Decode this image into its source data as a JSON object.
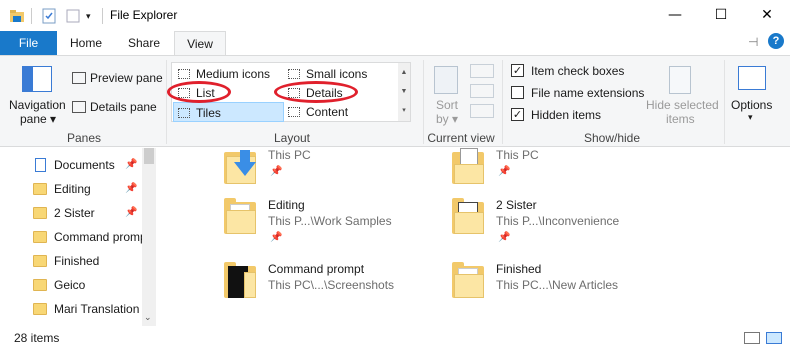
{
  "window": {
    "title": "File Explorer",
    "minimize": "—",
    "maximize": "☐",
    "close": "✕"
  },
  "tabs": {
    "file": "File",
    "home": "Home",
    "share": "Share",
    "view": "View"
  },
  "ribbon": {
    "panes": {
      "navigation_pane_line1": "Navigation",
      "navigation_pane_line2": "pane ▾",
      "preview_pane": "Preview pane",
      "details_pane": "Details pane",
      "group_label": "Panes"
    },
    "layout": {
      "medium_icons": "Medium icons",
      "small_icons": "Small icons",
      "list": "List",
      "details": "Details",
      "tiles": "Tiles",
      "content": "Content",
      "group_label": "Layout"
    },
    "current_view": {
      "sort_by_line1": "Sort",
      "sort_by_line2": "by ▾",
      "group_label": "Current view"
    },
    "show_hide": {
      "item_check_boxes": "Item check boxes",
      "item_check_boxes_checked": true,
      "file_name_extensions": "File name extensions",
      "file_name_extensions_checked": false,
      "hidden_items": "Hidden items",
      "hidden_items_checked": true,
      "hide_selected_line1": "Hide selected",
      "hide_selected_line2": "items",
      "group_label": "Show/hide"
    },
    "options": {
      "label": "Options",
      "arrow": "▾"
    }
  },
  "nav_pane": {
    "items": [
      {
        "label": "Documents",
        "pinned": true,
        "icon": "documents-icon"
      },
      {
        "label": "Editing",
        "pinned": true,
        "icon": "folder-icon"
      },
      {
        "label": "2 Sister",
        "pinned": true,
        "icon": "folder-icon"
      },
      {
        "label": "Command prompt",
        "pinned": false,
        "icon": "folder-icon"
      },
      {
        "label": "Finished",
        "pinned": false,
        "icon": "folder-icon"
      },
      {
        "label": "Geico",
        "pinned": false,
        "icon": "folder-icon"
      },
      {
        "label": "Mari Translation",
        "pinned": false,
        "icon": "folder-icon"
      }
    ]
  },
  "content": {
    "tiles": [
      {
        "name": "",
        "path": "This PC",
        "icon": "downloads-folder-icon"
      },
      {
        "name": "",
        "path": "This PC",
        "icon": "documents-folder-icon"
      },
      {
        "name": "Editing",
        "path": "This P...\\Work Samples",
        "icon": "folder-icon"
      },
      {
        "name": "2 Sister",
        "path": "This P...\\Inconvenience",
        "icon": "folder-icon"
      },
      {
        "name": "Command prompt",
        "path": "This PC\\...\\Screenshots",
        "icon": "folder-icon"
      },
      {
        "name": "Finished",
        "path": "This PC...\\New Articles",
        "icon": "folder-icon"
      }
    ]
  },
  "status": {
    "item_count": "28 items"
  },
  "colors": {
    "accent": "#1979ca",
    "highlight_oval": "#e0202c",
    "folder": "#f2c96a"
  }
}
